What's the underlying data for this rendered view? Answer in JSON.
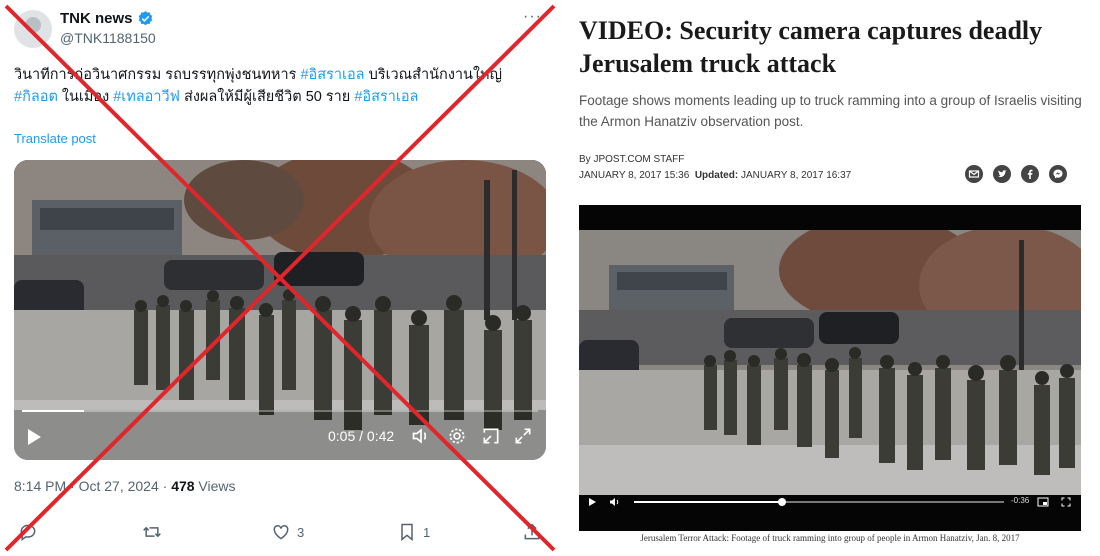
{
  "tweet": {
    "display_name": "TNK news",
    "handle": "@TNK1188150",
    "text_segments": [
      {
        "text": "วินาทีการก่อวินาศกรรม รถบรรทุกพุ่งชนทหาร ",
        "tag": false
      },
      {
        "text": "#อิสราเอล",
        "tag": true
      },
      {
        "text": " บริเวณสำนักงานใหญ่ ",
        "tag": false
      },
      {
        "text": "#กิลอต",
        "tag": true
      },
      {
        "text": " ในเมือง ",
        "tag": false
      },
      {
        "text": "#เทลอาวีฟ",
        "tag": true
      },
      {
        "text": " ส่งผลให้มีผู้เสียชีวิต 50 ราย ",
        "tag": false
      },
      {
        "text": "#อิสราเอล",
        "tag": true
      }
    ],
    "translate_label": "Translate post",
    "video": {
      "time": "0:05 / 0:42",
      "progress": 0.12
    },
    "timestamp": "8:14 PM · Oct 27, 2024 · ",
    "views_count": "478",
    "views_label": " Views",
    "actions": {
      "reply_count": "",
      "retweet_count": "",
      "like_count": "3",
      "bookmark_count": "1"
    },
    "accent_color": "#1d9bf0",
    "cross_color": "#e0262b",
    "icons": [
      "verified-icon",
      "more-icon",
      "play-icon",
      "volume-icon",
      "settings-icon",
      "pip-icon",
      "fullscreen-icon",
      "reply-icon",
      "retweet-icon",
      "like-icon",
      "bookmark-icon",
      "share-icon"
    ]
  },
  "article": {
    "headline": "VIDEO: Security camera captures deadly Jerusalem truck attack",
    "subhead": "Footage shows moments leading up to truck ramming into a group of Israelis visiting the Armon Hanatziv observation post.",
    "byline": "By JPOST.COM STAFF",
    "published": "JANUARY 8, 2017 15:36",
    "updated_label": "Updated:",
    "updated": "JANUARY 8, 2017 16:37",
    "share_icons": [
      "email-icon",
      "twitter-icon",
      "facebook-icon",
      "messenger-icon"
    ],
    "player": {
      "time": "-0:36",
      "progress": 0.4
    },
    "caption": "Jerusalem Terror Attack: Footage of truck ramming into group of people in Armon Hanatziv, Jan. 8, 2017"
  }
}
